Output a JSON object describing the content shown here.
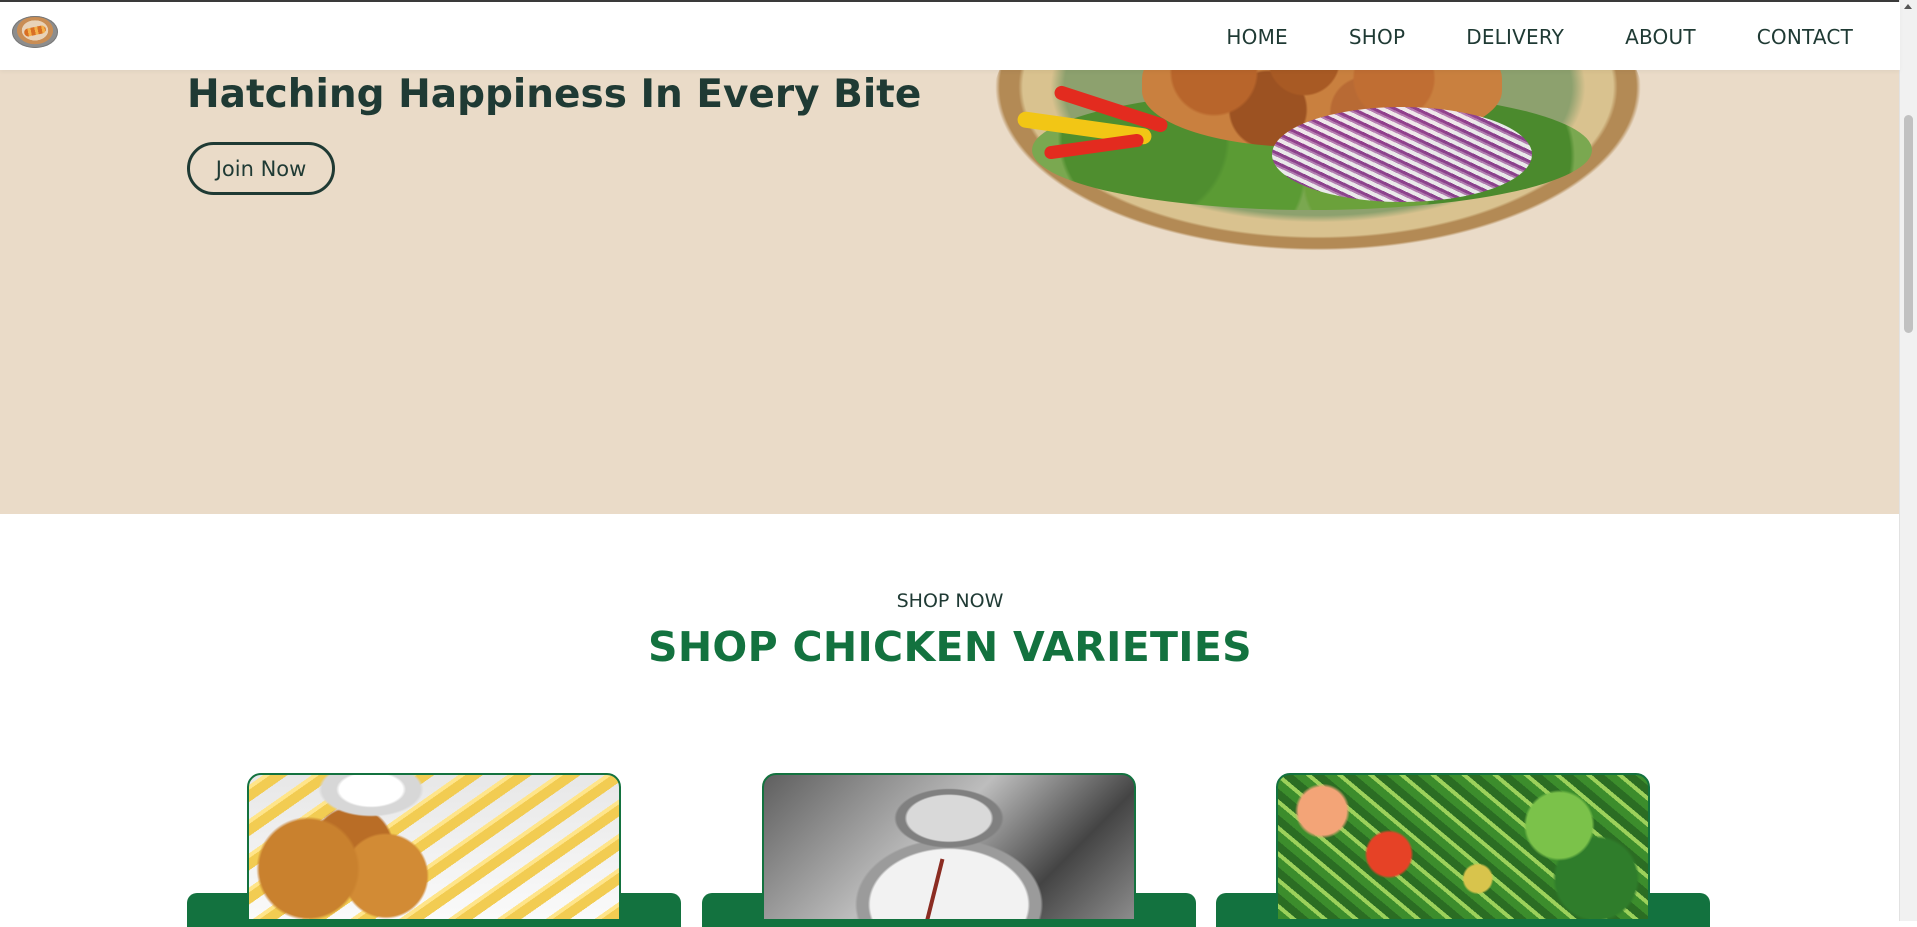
{
  "navigation": {
    "logo_icon": "fried-chicken-plate-logo-icon",
    "items": [
      {
        "label": "HOME"
      },
      {
        "label": "SHOP"
      },
      {
        "label": "DELIVERY"
      },
      {
        "label": "ABOUT"
      },
      {
        "label": "CONTACT"
      }
    ]
  },
  "hero": {
    "title": "Hatching Happiness In Every Bite",
    "join_label": "Join Now",
    "image": "fried-chicken-plate-with-salad"
  },
  "shop": {
    "subtitle": "SHOP NOW",
    "title": "SHOP CHICKEN VARIETIES",
    "cards": [
      {
        "image": "chicken-nuggets-and-fries"
      },
      {
        "image": "black-white-table-setting"
      },
      {
        "image": "fresh-salad"
      }
    ]
  },
  "colors": {
    "navbar_bg": "#ffffff",
    "hero_bg": "#eadbc8",
    "heading_text": "#1f3a34",
    "accent_green": "#13723f"
  }
}
